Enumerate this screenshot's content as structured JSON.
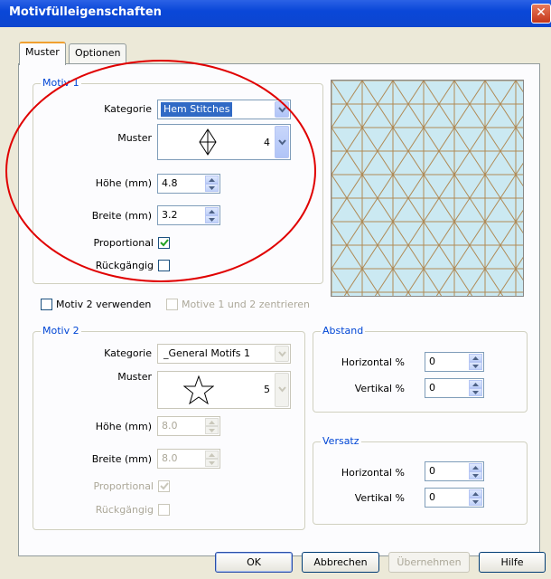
{
  "window": {
    "title": "Motivfülleigenschaften",
    "close_glyph": "✕"
  },
  "tabs": [
    {
      "label": "Muster",
      "active": true
    },
    {
      "label": "Optionen",
      "active": false
    }
  ],
  "motiv1": {
    "legend": "Motiv 1",
    "kategorie_label": "Kategorie",
    "kategorie_value": "Hem Stitches",
    "muster_label": "Muster",
    "muster_number": "4",
    "muster_icon": "diamond-stitch-icon",
    "hoehe_label": "Höhe (mm)",
    "hoehe_value": "4.8",
    "breite_label": "Breite (mm)",
    "breite_value": "3.2",
    "proportional_label": "Proportional",
    "proportional_checked": true,
    "rueckgaengig_label": "Rückgängig",
    "rueckgaengig_checked": false
  },
  "motiv2_toggle": {
    "label": "Motiv 2 verwenden",
    "checked": false
  },
  "center_toggle": {
    "label": "Motive 1 und 2 zentrieren",
    "checked": false,
    "enabled": false
  },
  "motiv2": {
    "legend": "Motiv 2",
    "kategorie_label": "Kategorie",
    "kategorie_value": "_General Motifs 1",
    "muster_label": "Muster",
    "muster_number": "5",
    "muster_icon": "star-outline-icon",
    "hoehe_label": "Höhe (mm)",
    "hoehe_value": "8.0",
    "breite_label": "Breite (mm)",
    "breite_value": "8.0",
    "proportional_label": "Proportional",
    "proportional_checked": true,
    "rueckgaengig_label": "Rückgängig",
    "rueckgaengig_checked": false
  },
  "abstand": {
    "legend": "Abstand",
    "horizontal_label": "Horizontal %",
    "horizontal_value": "0",
    "vertikal_label": "Vertikal %",
    "vertikal_value": "0"
  },
  "versatz": {
    "legend": "Versatz",
    "horizontal_label": "Horizontal %",
    "horizontal_value": "0",
    "vertikal_label": "Vertikal %",
    "vertikal_value": "0"
  },
  "buttons": {
    "ok": "OK",
    "cancel": "Abbrechen",
    "apply": "Übernehmen",
    "help": "Hilfe"
  },
  "colors": {
    "titlebar": "#0a47d8",
    "preview_bg": "#cbe9f2",
    "pattern_line": "#b08a55",
    "annotation": "#e00000",
    "group_legend": "#0046d5"
  }
}
